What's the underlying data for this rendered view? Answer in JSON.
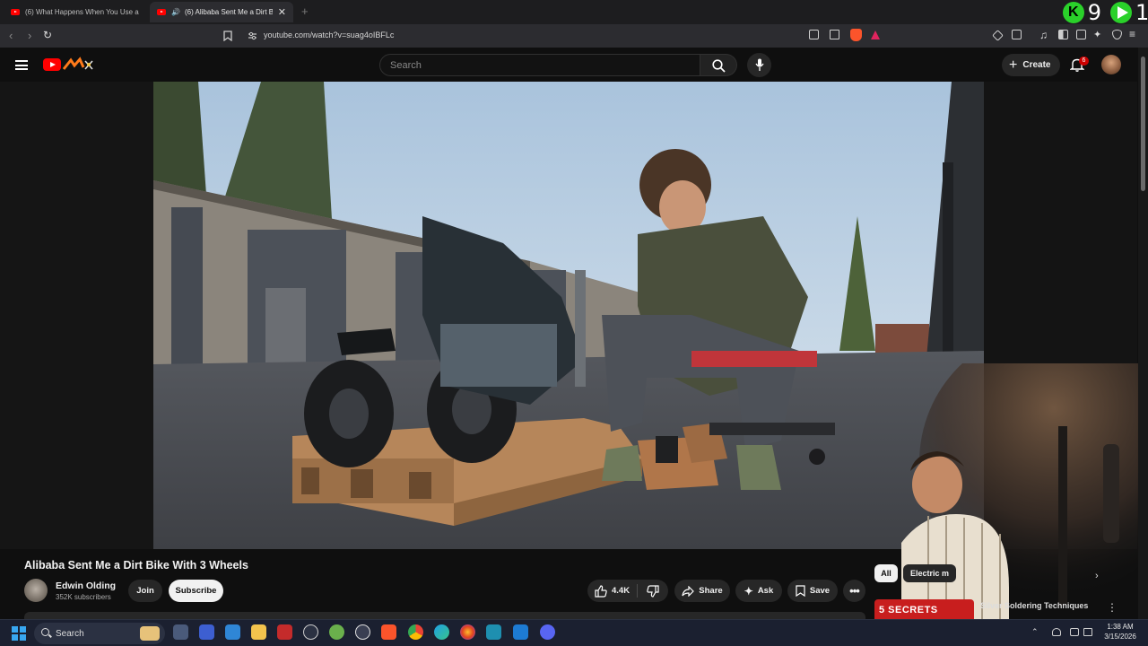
{
  "browser": {
    "tabs": [
      {
        "title": "(6) What Happens When You Use a S"
      },
      {
        "title": "(6) Alibaba Sent Me a Dirt Bik"
      }
    ],
    "url": "youtube.com/watch?v=suag4oIBFLc",
    "overlay": {
      "count_k": "9",
      "count_play": "1"
    }
  },
  "youtube": {
    "search_placeholder": "Search",
    "create_label": "Create",
    "notifications_count": "6"
  },
  "video": {
    "title": "Alibaba Sent Me a Dirt Bike With 3 Wheels",
    "channel": "Edwin Olding",
    "subscribers": "352K subscribers",
    "join_label": "Join",
    "subscribe_label": "Subscribe",
    "likes": "4.4K",
    "share_label": "Share",
    "ask_label": "Ask",
    "save_label": "Save"
  },
  "sidebar": {
    "chips": [
      "All",
      "Electric m"
    ],
    "recommendation": {
      "thumb_text": "5 SECRETS",
      "title": "Silver Soldering Techniques"
    }
  },
  "taskbar": {
    "search_label": "Search",
    "time": "1:38 AM",
    "date": "3/15/2026"
  },
  "colors": {
    "accent_red": "#ff0000",
    "overlay_green": "#2ad12a",
    "background": "#0f0f0f"
  }
}
